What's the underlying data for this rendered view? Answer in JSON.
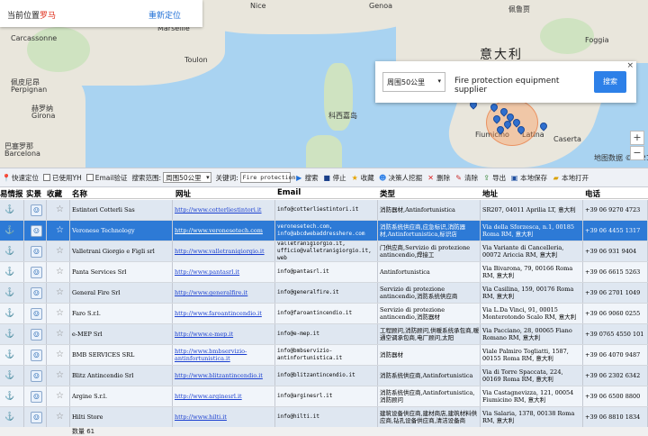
{
  "location_panel": {
    "label": "当前位置",
    "city": "罗马",
    "relocate": "重新定位"
  },
  "map": {
    "labels": {
      "nice": "Nice",
      "genoa": "Genoa",
      "marseille": "Marseille",
      "toulon": "Toulon",
      "carcassonne": "Carcassonne",
      "perpignan": "Perpignan",
      "perpignan_cn": "佩皮尼昂",
      "girona": "Girona",
      "girona_cn": "赫罗纳",
      "barcelona": "Barcelona",
      "barcelona_cn": "巴塞罗那",
      "italy": "意大利",
      "corsica": "科西嘉岛",
      "montenegro_cn": "Podgorica",
      "foggia": "Foggia",
      "caserta": "Caserta",
      "campobasso": "Campobasso",
      "bari": "Bari",
      "taranto": "Taranto",
      "potenza": "Potenza",
      "napoli": "Napoli",
      "latina": "Latina",
      "fiumicino": "Fiumicino",
      "sardinia_cn": "撒丁岛",
      "calabria": "Calabria",
      "sassari": "萨萨里",
      "olbia": "Olbia",
      "spoleto": "Spoleto",
      "frosinone": "弗罗西诺内",
      "ardea_cn": "罗马涅洛里",
      "spalato": "Split",
      "ajaccio": "阿雅克肖",
      "marche": "马尔凯大区",
      "perugia": "佩鲁贾",
      "bastia": "巴斯蒂亚",
      "terni": "特尔尼",
      "tyrrhenian": "第勒尼安海",
      "map_data": "地图数据 ©2021"
    }
  },
  "search_panel": {
    "radius": "周围50公里",
    "query": "Fire protection equipment supplier",
    "button": "搜索",
    "close": "×"
  },
  "toolbar": {
    "quick_locate": "快速定位",
    "used_yh": "已使用YH",
    "email_verify": "Email验证",
    "range_label": "搜索范围:",
    "range_value": "周围50公里",
    "keyword_label": "关键词:",
    "keyword_value": "Fire protection",
    "search": "搜索",
    "stop": "停止",
    "favorite": "收藏",
    "deep_mine": "决策人挖掘",
    "delete": "删除",
    "clear": "清除",
    "export": "导出",
    "save_local": "本地保存",
    "open_local": "本地打开"
  },
  "table": {
    "headers": [
      "易情报",
      "实景",
      "收藏",
      "名称",
      "网址",
      "Email",
      "类型",
      "地址",
      "电话"
    ],
    "rows": [
      {
        "name": "Estintori Cotterli Sas",
        "url": "http://www.cotterliestintori.it",
        "email": "info@cotterliestintori.it",
        "type": "消防器材,Antinfortunistica",
        "address": "SR207, 04011 Aprilia LT, 意大利",
        "phone": "+39 06 9270 4723"
      },
      {
        "name": "Veronese Technology",
        "url": "http://www.veronesetech.com",
        "email": "veronesetech.com, info@abcdwebaddresshere.com",
        "type": "消防系统供应商,应急标识,消防器材,Antinfortunistica,标识店",
        "address": "Via della Sforzesca, n.1, 00185 Roma RM, 意大利",
        "phone": "+39 06 4455 1317"
      },
      {
        "name": "Valletrani Giorgio e Figli srl",
        "url": "http://www.valletranigiorgio.it",
        "email": "valletranigiorgio.it, ufficio@valletranigiorgio.it, web",
        "type": "门供应商,Servizio di protezione antincendio,焊接工",
        "address": "Via Variante di Cancelleria, 00072 Ariccia RM, 意大利",
        "phone": "+39 06 931 9404"
      },
      {
        "name": "Panta Services Srl",
        "url": "http://www.pantasrl.it",
        "email": "info@pantasrl.it",
        "type": "Antinfortunistica",
        "address": "Via Bivarona, 79, 00166 Roma RM, 意大利",
        "phone": "+39 06 6615 5263"
      },
      {
        "name": "General Fire Srl",
        "url": "http://www.generalfire.it",
        "email": "info@generalfire.it",
        "type": "Servizio di protezione antincendio,消防系统供应商",
        "address": "Via Casilina, 159, 00176 Roma RM, 意大利",
        "phone": "+39 06 2701 1049"
      },
      {
        "name": "Faro S.r.l.",
        "url": "http://www.faroantincendio.it",
        "email": "info@faroantincendio.it",
        "type": "Servizio di protezione antincendio,消防器材",
        "address": "Via L.Da Vinci, 91, 00015 Monterotondo Scalo RM, 意大利",
        "phone": "+39 06 9060 0255"
      },
      {
        "name": "e-MEP Srl",
        "url": "http://www.e-mep.it",
        "email": "info@e-mep.it",
        "type": "工程顾问,消防顾问,供暖系统承包商,暖通空调承包商,电厂顾问,太阳",
        "address": "Via Pacciano, 28, 00065 Fiano Romano RM, 意大利",
        "phone": "+39 0765 4550 101"
      },
      {
        "name": "BMB SERVICES SRL",
        "url": "http://www.bmbservizio-antinfortunistica.it",
        "email": "info@bmbservizio-antinfortunistica.it",
        "type": "消防器材",
        "address": "Viale Palmiro Togliatti, 1587, 00155 Roma RM, 意大利",
        "phone": "+39 06 4070 9487"
      },
      {
        "name": "Blitz Antincendio Srl",
        "url": "http://www.blitzantincendio.it",
        "email": "info@blitzantincendio.it",
        "type": "消防系统供应商,Antinfortunistica",
        "address": "Via di Torre Spaccata, 224, 00169 Roma RM, 意大利",
        "phone": "+39 06 2302 6342"
      },
      {
        "name": "Argine S.r.l.",
        "url": "http://www.arginesrl.it",
        "email": "info@arginesrl.it",
        "type": "消防系统供应商,Antinfortunistica,消防顾问",
        "address": "Via Castagnevizza, 121, 00054 Fiumicino RM, 意大利",
        "phone": "+39 06 6500 8800"
      },
      {
        "name": "Hilti Store",
        "url": "http://www.hilti.it",
        "email": "info@hilti.it",
        "type": "建筑设备供应商,建材商店,建筑材料供应商,钻孔设备供应商,清洁设备商",
        "address": "Via Salaria, 1378, 00138 Roma RM, 意大利",
        "phone": "+39 06 8810 1834"
      }
    ]
  },
  "status": {
    "count_label": "数量 61"
  }
}
